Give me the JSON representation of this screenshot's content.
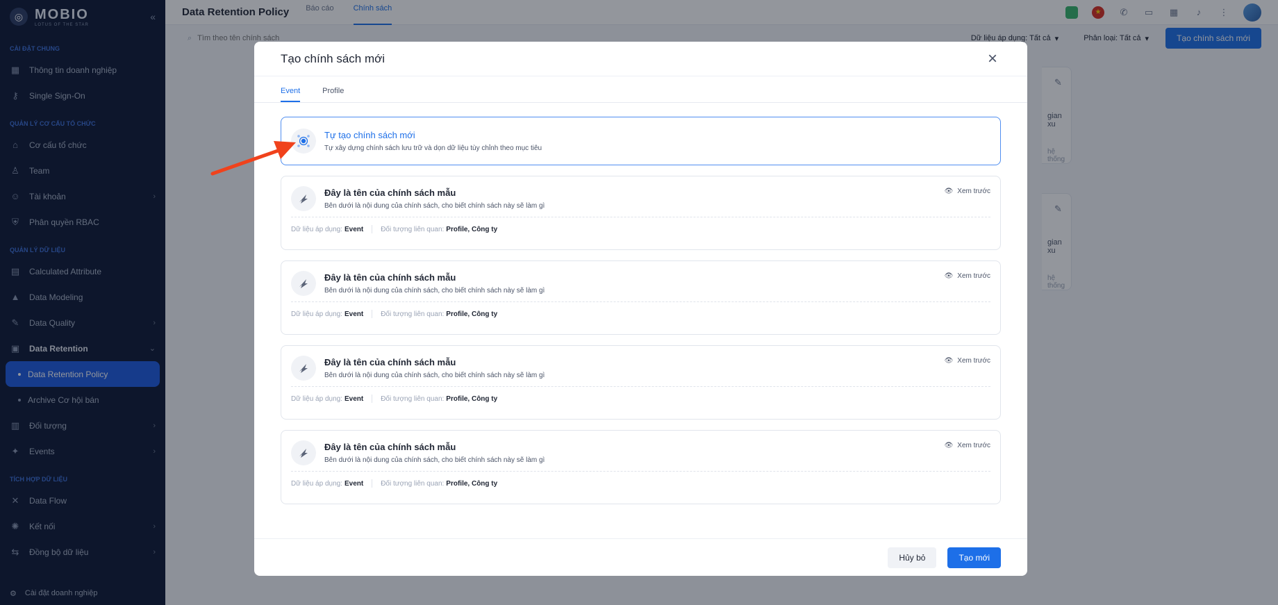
{
  "brand": {
    "name": "MOBIO",
    "sub": "LOTUS OF THE STAR"
  },
  "sidebar": {
    "sections": [
      {
        "title": "CÀI ĐẶT CHUNG",
        "items": [
          {
            "label": "Thông tin doanh nghiệp",
            "icon": "building-icon"
          },
          {
            "label": "Single Sign-On",
            "icon": "key-icon"
          }
        ]
      },
      {
        "title": "QUẢN LÝ CƠ CẤU TỔ CHỨC",
        "items": [
          {
            "label": "Cơ cấu tổ chức",
            "icon": "org-icon"
          },
          {
            "label": "Team",
            "icon": "team-icon"
          },
          {
            "label": "Tài khoản",
            "icon": "user-icon",
            "chevron": true
          },
          {
            "label": "Phân quyền RBAC",
            "icon": "shield-icon"
          }
        ]
      },
      {
        "title": "QUẢN LÝ DỮ LIỆU",
        "items": [
          {
            "label": "Calculated Attribute",
            "icon": "calc-icon"
          },
          {
            "label": "Data Modeling",
            "icon": "model-icon"
          },
          {
            "label": "Data Quality",
            "icon": "quality-icon",
            "chevron": true
          },
          {
            "label": "Data Retention",
            "icon": "retention-icon",
            "chevron": true,
            "expanded": true
          },
          {
            "label": "Data Retention Policy",
            "sub": true,
            "active": true
          },
          {
            "label": "Archive Cơ hội bán",
            "sub": true
          },
          {
            "label": "Đối tượng",
            "icon": "object-icon",
            "chevron": true
          },
          {
            "label": "Events",
            "icon": "events-icon",
            "chevron": true
          }
        ]
      },
      {
        "title": "TÍCH HỢP DỮ LIỆU",
        "items": [
          {
            "label": "Data Flow",
            "icon": "flow-icon"
          },
          {
            "label": "Kết nối",
            "icon": "connect-icon",
            "chevron": true
          },
          {
            "label": "Đồng bộ dữ liệu",
            "icon": "sync-icon",
            "chevron": true
          }
        ]
      }
    ],
    "footer": "Cài đặt doanh nghiệp"
  },
  "header": {
    "title": "Data Retention Policy",
    "tabs": [
      "Báo cáo",
      "Chính sách"
    ],
    "active_tab": 1
  },
  "filters": {
    "search_placeholder": "Tìm theo tên chính sách",
    "data_filter": "Dữ liệu áp dụng: Tất cả",
    "category_filter": "Phân loại: Tất cả",
    "create_button": "Tạo chính sách mới"
  },
  "bg_cards": [
    {
      "frag": "gian xu",
      "frag2": "hệ thống"
    },
    {
      "frag": "gian xu",
      "frag2": "hệ thống"
    }
  ],
  "modal": {
    "title": "Tạo chính sách mới",
    "tabs": [
      "Event",
      "Profile"
    ],
    "custom": {
      "title": "Tự tạo chính sách mới",
      "desc": "Tự xây dựng chính sách lưu trữ và dọn dữ liệu tùy chỉnh theo mục tiêu"
    },
    "templates": [
      {
        "name": "Đây là tên của chính sách mẫu",
        "desc": "Bên dưới là nội dung của chính sách, cho biết chính sách này sẽ làm gì",
        "preview": "Xem trước",
        "data_label": "Dữ liệu áp dụng:",
        "data_value": "Event",
        "obj_label": "Đối tượng liên quan:",
        "obj_value": "Profile, Công ty"
      },
      {
        "name": "Đây là tên của chính sách mẫu",
        "desc": "Bên dưới là nội dung của chính sách, cho biết chính sách này sẽ làm gì",
        "preview": "Xem trước",
        "data_label": "Dữ liệu áp dụng:",
        "data_value": "Event",
        "obj_label": "Đối tượng liên quan:",
        "obj_value": "Profile, Công ty"
      },
      {
        "name": "Đây là tên của chính sách mẫu",
        "desc": "Bên dưới là nội dung của chính sách, cho biết chính sách này sẽ làm gì",
        "preview": "Xem trước",
        "data_label": "Dữ liệu áp dụng:",
        "data_value": "Event",
        "obj_label": "Đối tượng liên quan:",
        "obj_value": "Profile, Công ty"
      },
      {
        "name": "Đây là tên của chính sách mẫu",
        "desc": "Bên dưới là nội dung của chính sách, cho biết chính sách này sẽ làm gì",
        "preview": "Xem trước",
        "data_label": "Dữ liệu áp dụng:",
        "data_value": "Event",
        "obj_label": "Đối tượng liên quan:",
        "obj_value": "Profile, Công ty"
      }
    ],
    "cancel": "Hủy bỏ",
    "create": "Tạo mới"
  },
  "colors": {
    "accent": "#1d6fe8",
    "sidebar_bg": "#0b1733",
    "arrow": "#f0421c"
  }
}
